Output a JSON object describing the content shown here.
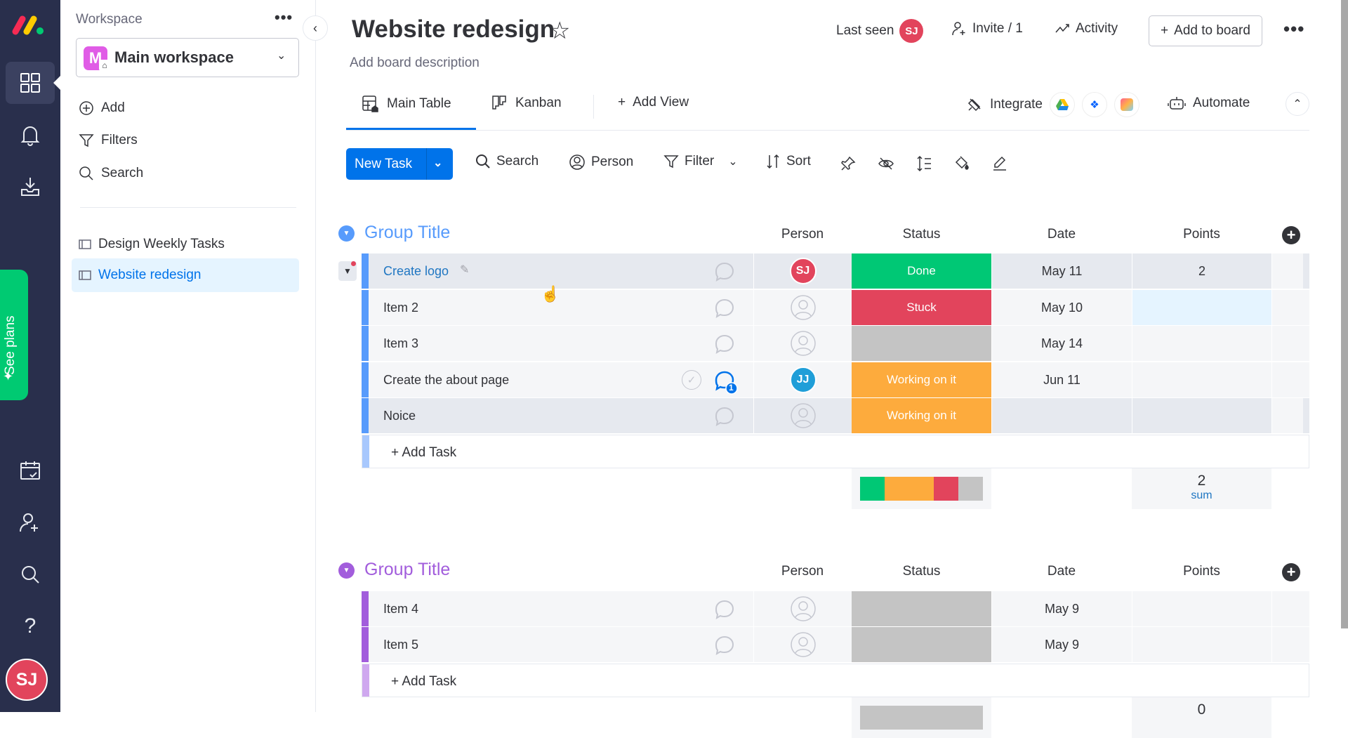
{
  "leftnav": {
    "icons": [
      "monday-logo",
      "work-management-icon",
      "bell-icon",
      "inbox-icon",
      "calendar-check-icon",
      "invite-member-icon",
      "search-icon",
      "help-icon"
    ],
    "see_plans": "See plans",
    "user_initials": "SJ"
  },
  "sidebar": {
    "workspace_label": "Workspace",
    "workspace_name": "Main workspace",
    "workspace_badge": "M",
    "actions": [
      {
        "label": "Add",
        "icon": "plus-circle-icon"
      },
      {
        "label": "Filters",
        "icon": "filter-icon"
      },
      {
        "label": "Search",
        "icon": "search-icon"
      }
    ],
    "boards": [
      {
        "label": "Design Weekly Tasks",
        "active": false
      },
      {
        "label": "Website redesign",
        "active": true
      }
    ]
  },
  "header": {
    "title": "Website redesign",
    "description": "Add board description",
    "last_seen_label": "Last seen",
    "last_seen_initials": "SJ",
    "invite_label": "Invite / 1",
    "activity_label": "Activity",
    "add_to_board_label": "Add to board"
  },
  "tabs": {
    "items": [
      {
        "label": "Main Table",
        "active": true
      },
      {
        "label": "Kanban",
        "active": false
      }
    ],
    "add_view_label": "Add View",
    "integrate_label": "Integrate",
    "automate_label": "Automate"
  },
  "toolbar": {
    "new_task_label": "New Task",
    "search_label": "Search",
    "person_label": "Person",
    "filter_label": "Filter",
    "sort_label": "Sort"
  },
  "columns": {
    "person": "Person",
    "status": "Status",
    "date": "Date",
    "points": "Points"
  },
  "colors": {
    "done": "#00c875",
    "stuck": "#e2445c",
    "working": "#fdab3d",
    "empty": "#c4c4c4",
    "group1": "#579bfc",
    "group2": "#a25ddc",
    "accent": "#0073ea"
  },
  "groups": [
    {
      "title": "Group Title",
      "add_task_label": "+ Add Task",
      "items": [
        {
          "name": "Create logo",
          "person": "SJ",
          "status": "Done",
          "date": "May 11",
          "points": "2"
        },
        {
          "name": "Item 2",
          "person": "",
          "status": "Stuck",
          "date": "May 10",
          "points": ""
        },
        {
          "name": "Item 3",
          "person": "",
          "status": "",
          "date": "May 14",
          "points": ""
        },
        {
          "name": "Create the about page",
          "person": "JJ",
          "status": "Working on it",
          "date": "Jun 11",
          "points": "",
          "comments": "1"
        },
        {
          "name": "Noice",
          "person": "",
          "status": "Working on it",
          "date": "",
          "points": ""
        }
      ],
      "summary": {
        "points_value": "2",
        "points_label": "sum",
        "status_distribution": {
          "Done": 1,
          "Working on it": 2,
          "Stuck": 1,
          "Empty": 1
        }
      }
    },
    {
      "title": "Group Title",
      "add_task_label": "+ Add Task",
      "items": [
        {
          "name": "Item 4",
          "person": "",
          "status": "",
          "date": "May 9",
          "points": ""
        },
        {
          "name": "Item 5",
          "person": "",
          "status": "",
          "date": "May 9",
          "points": ""
        }
      ],
      "summary": {
        "points_value": "0",
        "status_distribution": {
          "Empty": 2
        }
      }
    }
  ]
}
